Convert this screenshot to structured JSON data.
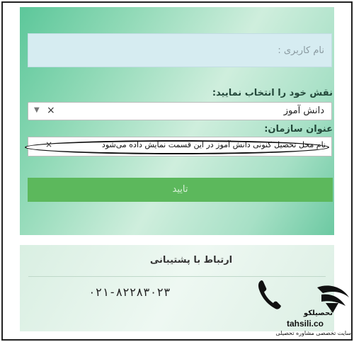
{
  "form": {
    "username_placeholder": "نام کاربری :",
    "role_label": "نقش خود را انتخاب نمایید:",
    "role_value": "دانش آموز",
    "role_clear": "×",
    "role_caret": "▼",
    "org_label": "عنوان سازمان:",
    "org_value": "نام محل تحصیل کنونی دانش آموز در این قسمت نمایش داده می‌شود",
    "org_clear": "×",
    "submit_label": "تایید"
  },
  "support": {
    "title": "ارتباط با پشتیبانی",
    "phone": "۰۲۱-۸۲۲۸۳۰۲۳"
  },
  "watermark": {
    "name": "تحصیلکو",
    "url": "tahsili.co",
    "tagline": "سایت تخصصی مشاوره تحصیلی"
  }
}
